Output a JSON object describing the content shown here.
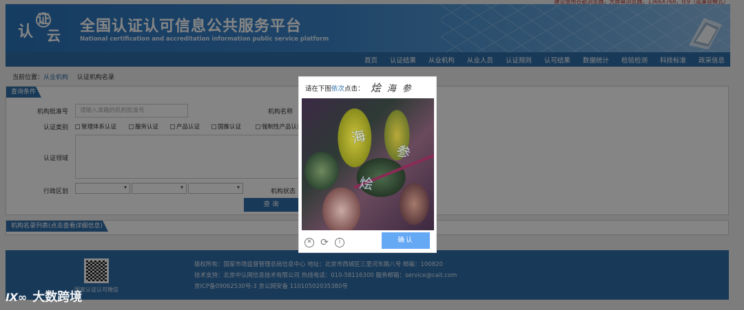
{
  "top_note": "建议使用谷歌浏览器，大屏幕浏览器，1366X768，IE9（或兼容模式）",
  "header": {
    "logo_chars": [
      "认",
      "证",
      "云"
    ],
    "title_cn": "全国认证认可信息公共服务平台",
    "title_en": "National certification and accreditation information public service platform"
  },
  "nav": [
    "首页",
    "认证结果",
    "从业机构",
    "从业人员",
    "认证规则",
    "认可结果",
    "数据统计",
    "检验检测",
    "科技标准",
    "政采信息"
  ],
  "breadcrumb": {
    "label": "当前位置：",
    "link": "从业机构",
    "current": "认证机构名录"
  },
  "query": {
    "title": "查询条件",
    "approval_label": "机构批准号",
    "approval_placeholder": "请输入准确的机构批准号",
    "name_label": "机构名称",
    "cert_type_label": "认证类别",
    "cert_types": [
      "管理体系认证",
      "服务认证",
      "产品认证",
      "国推认证",
      "强制性产品认证"
    ],
    "field_label": "认证领域",
    "region_label": "行政区划",
    "status_label": "机构状态",
    "button": "查询"
  },
  "list_title": "机构名录列表(点击查看详细信息)",
  "footer": {
    "qr_label": "国家认证认可微信",
    "line1": "版权所有：国家市场监督管理总局信息中心    地址：北京市西城区三里河东路八号    邮编：100820",
    "line2": "技术支持：北京中认网信息技术有限公司    热线电话：010-58116300    服务邮箱：service@cait.com",
    "line3": "京ICP备09062530号-3      京公网安备 11010502035380号"
  },
  "watermark": {
    "logo": "Ⅸ∞",
    "text": "大数跨境"
  },
  "captcha": {
    "instruction_pre": "请在下图",
    "instruction_hl": "依次",
    "instruction_post": "点击：",
    "target_chars": [
      "烩",
      "海",
      "参"
    ],
    "image_chars": [
      "海",
      "参",
      "烩"
    ],
    "close_icon": "close-icon",
    "refresh_icon": "refresh-icon",
    "info_icon": "info-icon",
    "confirm": "确认"
  },
  "colors": {
    "primary": "#2f6ea9",
    "confirm": "#65a9f4",
    "overlay": "rgba(0,0,0,0.48)"
  }
}
